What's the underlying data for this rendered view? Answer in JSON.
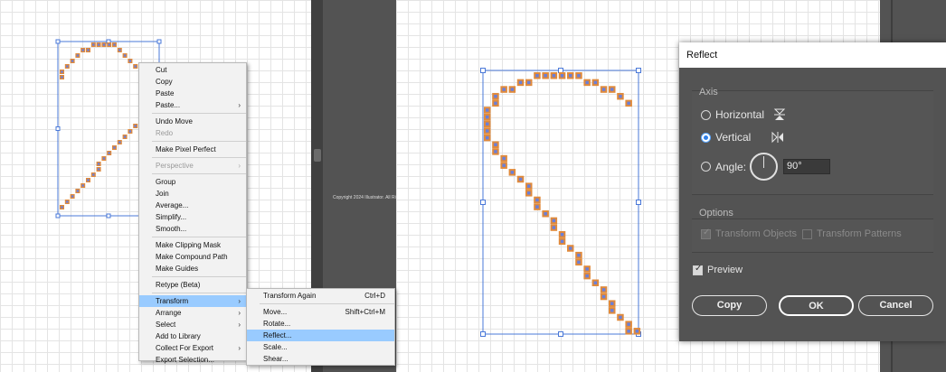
{
  "copyright": "Copyright 2024 Illustrator. All Rights Reserved.",
  "context_menu": {
    "items": [
      {
        "label": "Cut"
      },
      {
        "label": "Copy"
      },
      {
        "label": "Paste"
      },
      {
        "label": "Paste..."
      },
      {
        "label": "Undo Move"
      },
      {
        "label": "Redo"
      },
      {
        "label": "Make Pixel Perfect"
      },
      {
        "label": "Perspective"
      },
      {
        "label": "Group"
      },
      {
        "label": "Join"
      },
      {
        "label": "Average..."
      },
      {
        "label": "Simplify..."
      },
      {
        "label": "Smooth..."
      },
      {
        "label": "Make Clipping Mask"
      },
      {
        "label": "Make Compound Path"
      },
      {
        "label": "Make Guides"
      },
      {
        "label": "Retype (Beta)"
      },
      {
        "label": "Transform"
      },
      {
        "label": "Arrange"
      },
      {
        "label": "Select"
      },
      {
        "label": "Add to Library"
      },
      {
        "label": "Collect For Export"
      },
      {
        "label": "Export Selection..."
      }
    ]
  },
  "transform_submenu": {
    "items": [
      {
        "label": "Transform Again",
        "shortcut": "Ctrl+D"
      },
      {
        "label": "Move...",
        "shortcut": "Shift+Ctrl+M"
      },
      {
        "label": "Rotate...",
        "shortcut": ""
      },
      {
        "label": "Reflect...",
        "shortcut": ""
      },
      {
        "label": "Scale...",
        "shortcut": ""
      },
      {
        "label": "Shear...",
        "shortcut": ""
      }
    ]
  },
  "reflect_dialog": {
    "title": "Reflect",
    "axis_label": "Axis",
    "horizontal_label": "Horizontal",
    "vertical_label": "Vertical",
    "angle_label": "Angle:",
    "angle_value": "90°",
    "selected_axis": "vertical",
    "options_label": "Options",
    "transform_objects_label": "Transform Objects",
    "transform_patterns_label": "Transform Patterns",
    "preview_label": "Preview",
    "copy_button": "Copy",
    "ok_button": "OK",
    "cancel_button": "Cancel"
  },
  "colors": {
    "pixel_fill": "#e08a3c",
    "pixel_center": "#6a7fd8",
    "selection": "#4a78d8",
    "menu_highlight": "#99cbff"
  }
}
